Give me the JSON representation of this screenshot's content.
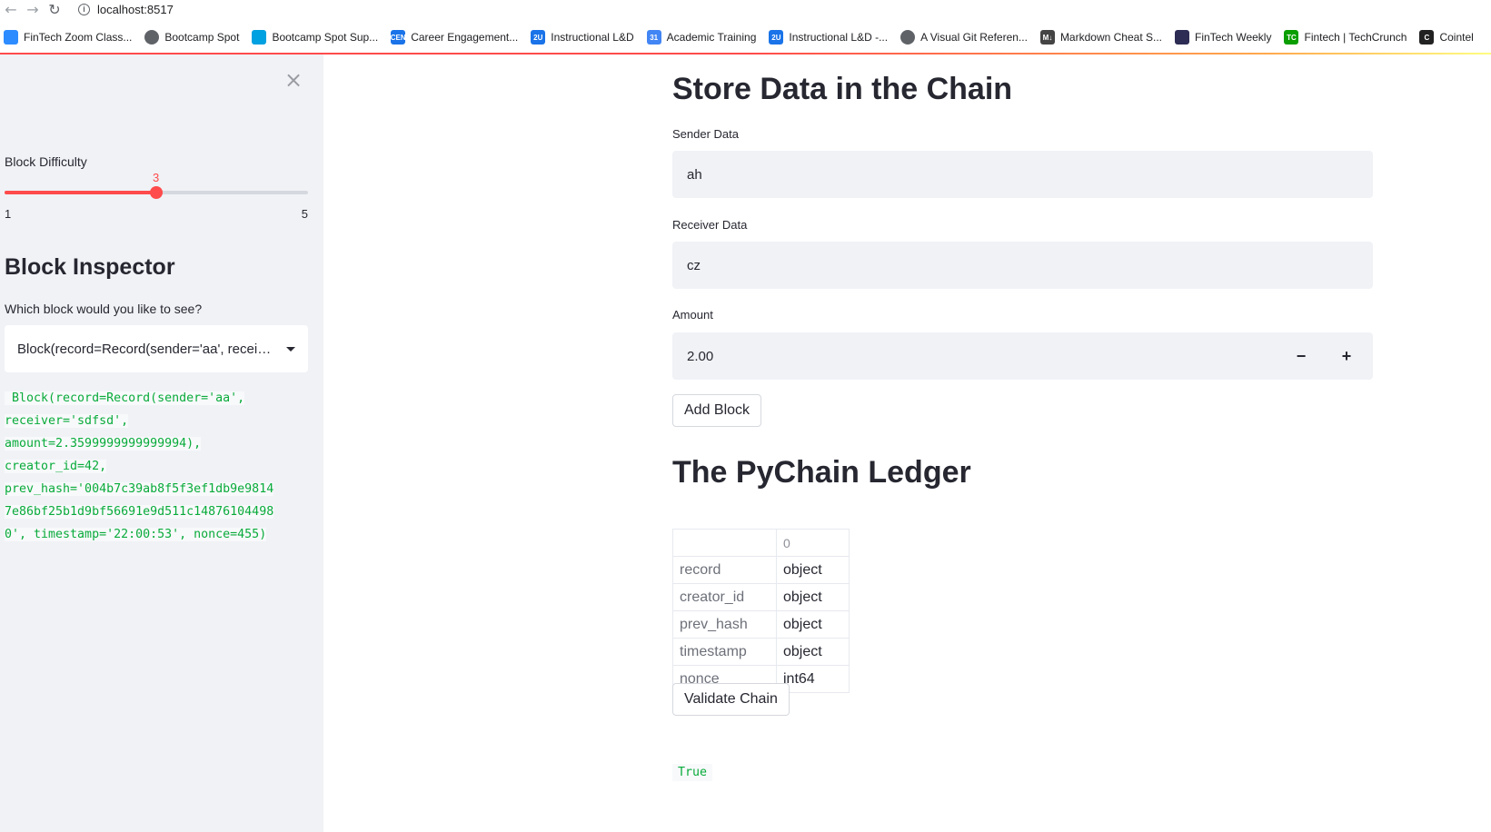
{
  "browser": {
    "url": "localhost:8517",
    "bookmarks": [
      {
        "label": "FinTech Zoom Class...",
        "icon": "zoom-icon",
        "color": "#2d8cff",
        "glyph": ""
      },
      {
        "label": "Bootcamp Spot",
        "icon": "globe-icon",
        "color": "#5f6368",
        "glyph": ""
      },
      {
        "label": "Bootcamp Spot Sup...",
        "icon": "salesforce-icon",
        "color": "#00a1e0",
        "glyph": ""
      },
      {
        "label": "Career Engagement...",
        "icon": "cen-icon",
        "color": "#1a73e8",
        "glyph": "CEN"
      },
      {
        "label": "Instructional L&D",
        "icon": "2u-icon",
        "color": "#1a73e8",
        "glyph": "2U"
      },
      {
        "label": "Academic Training",
        "icon": "calendar-icon",
        "color": "#4285f4",
        "glyph": "31"
      },
      {
        "label": "Instructional L&D -...",
        "icon": "2u-icon",
        "color": "#1a73e8",
        "glyph": "2U"
      },
      {
        "label": "A Visual Git Referen...",
        "icon": "globe-icon",
        "color": "#5f6368",
        "glyph": ""
      },
      {
        "label": "Markdown Cheat S...",
        "icon": "markdown-icon",
        "color": "#444444",
        "glyph": "M↓"
      },
      {
        "label": "FinTech Weekly",
        "icon": "fintech-weekly-icon",
        "color": "#2c2c54",
        "glyph": ""
      },
      {
        "label": "Fintech | TechCrunch",
        "icon": "techcrunch-icon",
        "color": "#0a9e01",
        "glyph": "TC"
      },
      {
        "label": "Cointel",
        "icon": "cointelegraph-icon",
        "color": "#222222",
        "glyph": "C"
      }
    ]
  },
  "sidebar": {
    "difficulty_label": "Block Difficulty",
    "difficulty": {
      "value": 3,
      "min": 1,
      "max": 5,
      "value_text": "3",
      "min_text": "1",
      "max_text": "5"
    },
    "inspector_title": "Block Inspector",
    "which_label": "Which block would you like to see?",
    "selected_block": "Block(record=Record(sender='aa', receiver='sdfsd', amount=2.3599999999999994), creator_id=42, ...",
    "block_detail_lines": [
      " Block(record=Record(sender='aa',",
      "receiver='sdfsd',",
      "amount=2.3599999999999994),",
      "creator_id=42,",
      "prev_hash='004b7c39ab8f5f3ef1db9e9814",
      "7e86bf25b1d9bf56691e9d511c14876104498",
      "0', timestamp='22:00:53', nonce=455)"
    ]
  },
  "main": {
    "title": "Store Data in the Chain",
    "sender_label": "Sender Data",
    "sender_value": "ah",
    "receiver_label": "Receiver Data",
    "receiver_value": "cz",
    "amount_label": "Amount",
    "amount_value": "2.00",
    "minus_label": "−",
    "plus_label": "+",
    "add_block_label": "Add Block",
    "ledger_title": "The PyChain Ledger",
    "ledger": {
      "column_header": "0",
      "rows": [
        {
          "field": "record",
          "type": "object"
        },
        {
          "field": "creator_id",
          "type": "object"
        },
        {
          "field": "prev_hash",
          "type": "object"
        },
        {
          "field": "timestamp",
          "type": "object"
        },
        {
          "field": "nonce",
          "type": "int64"
        }
      ]
    },
    "validate_label": "Validate Chain",
    "validate_result": "True"
  },
  "colors": {
    "accent": "#ff4b4b",
    "code_green": "#09ab3b",
    "sidebar_bg": "#f0f2f6"
  }
}
